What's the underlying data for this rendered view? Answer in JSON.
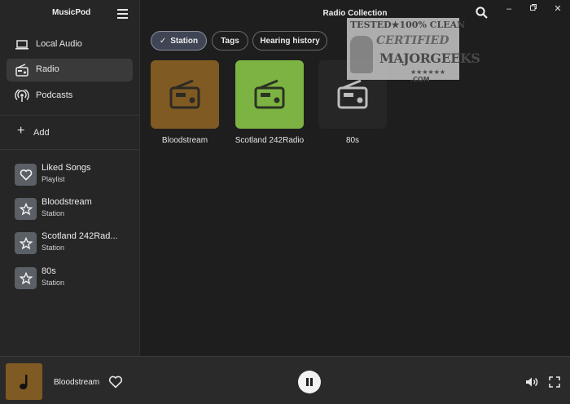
{
  "app": {
    "title": "MusicPod"
  },
  "nav": [
    {
      "label": "Local Audio",
      "icon": "laptop-icon",
      "active": false
    },
    {
      "label": "Radio",
      "icon": "radio-icon",
      "active": true
    },
    {
      "label": "Podcasts",
      "icon": "podcast-icon",
      "active": false
    }
  ],
  "add": {
    "label": "Add"
  },
  "library": [
    {
      "title": "Liked Songs",
      "subtitle": "Playlist",
      "icon": "heart-icon"
    },
    {
      "title": "Bloodstream",
      "subtitle": "Station",
      "icon": "star-icon"
    },
    {
      "title": "Scotland 242Rad...",
      "subtitle": "Station",
      "icon": "star-icon"
    },
    {
      "title": "80s",
      "subtitle": "Station",
      "icon": "star-icon"
    }
  ],
  "main": {
    "title": "Radio Collection",
    "chips": [
      {
        "label": "Station",
        "selected": true
      },
      {
        "label": "Tags",
        "selected": false
      },
      {
        "label": "Hearing history",
        "selected": false
      }
    ],
    "stations": [
      {
        "label": "Bloodstream",
        "color": "#7f5a22"
      },
      {
        "label": "Scotland 242Radio",
        "color": "#7cb342"
      },
      {
        "label": "80s",
        "color": "#262626"
      }
    ]
  },
  "badge": {
    "line1": "TESTED★100% CLEAN",
    "line2": "CERTIFIED",
    "line3": "MAJORGEEKS",
    "line4": "★★★★★★ .COM"
  },
  "player": {
    "now_playing": "Bloodstream"
  },
  "colors": {
    "accent_chip": "#3f4554",
    "background": "#1e1e1e",
    "sidebar": "#262626"
  }
}
